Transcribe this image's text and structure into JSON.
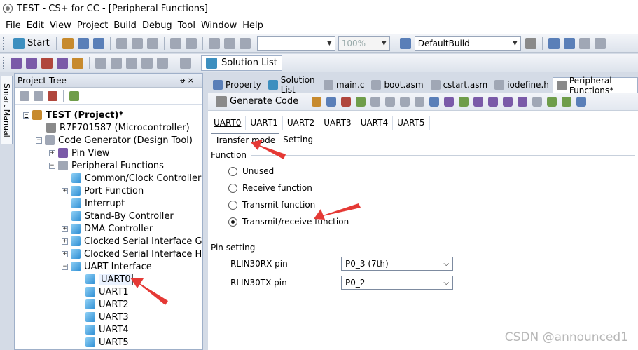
{
  "window": {
    "title": "TEST - CS+ for CC - [Peripheral Functions]"
  },
  "menu": [
    "File",
    "Edit",
    "View",
    "Project",
    "Build",
    "Debug",
    "Tool",
    "Window",
    "Help"
  ],
  "toolbar": {
    "start_label": "Start",
    "zoom_value": "100%",
    "build_config": "DefaultBuild",
    "solution_list_label": "Solution List"
  },
  "project_tree": {
    "header": "Project Tree",
    "pin_glyph": "ᵽ ×",
    "side_tab": "Smart Manual",
    "nodes": {
      "project": "TEST (Project)*",
      "mcu": "R7F701587 (Microcontroller)",
      "codegen": "Code Generator (Design Tool)",
      "pinview": "Pin View",
      "periph": "Peripheral Functions",
      "clock": "Common/Clock Controller",
      "port": "Port Function",
      "interrupt": "Interrupt",
      "standby": "Stand-By Controller",
      "dma": "DMA Controller",
      "csig": "Clocked Serial Interface G",
      "csih": "Clocked Serial Interface H",
      "uart_if": "UART Interface",
      "uart0": "UART0",
      "uart1": "UART1",
      "uart2": "UART2",
      "uart3": "UART3",
      "uart4": "UART4",
      "uart5": "UART5"
    }
  },
  "doc_tabs": [
    "Property",
    "Solution List",
    "main.c",
    "boot.asm",
    "cstart.asm",
    "iodefine.h",
    "Peripheral Functions*"
  ],
  "generate_code_label": "Generate Code",
  "uart_tabs": [
    "UART0",
    "UART1",
    "UART2",
    "UART3",
    "UART4",
    "UART5"
  ],
  "sub_tabs": [
    "Transfer mode",
    "Setting"
  ],
  "function_group": {
    "title": "Function",
    "options": [
      "Unused",
      "Receive function",
      "Transmit function",
      "Transmit/receive function"
    ],
    "selected": "Transmit/receive function"
  },
  "pin_group": {
    "title": "Pin setting",
    "rx_label": "RLIN30RX pin",
    "rx_value": "P0_3 (7th)",
    "tx_label": "RLIN30TX pin",
    "tx_value": "P0_2"
  },
  "watermark": "CSDN @announced1",
  "colors": {
    "annotation_arrow": "#e53935",
    "selection_border": "#555555"
  }
}
